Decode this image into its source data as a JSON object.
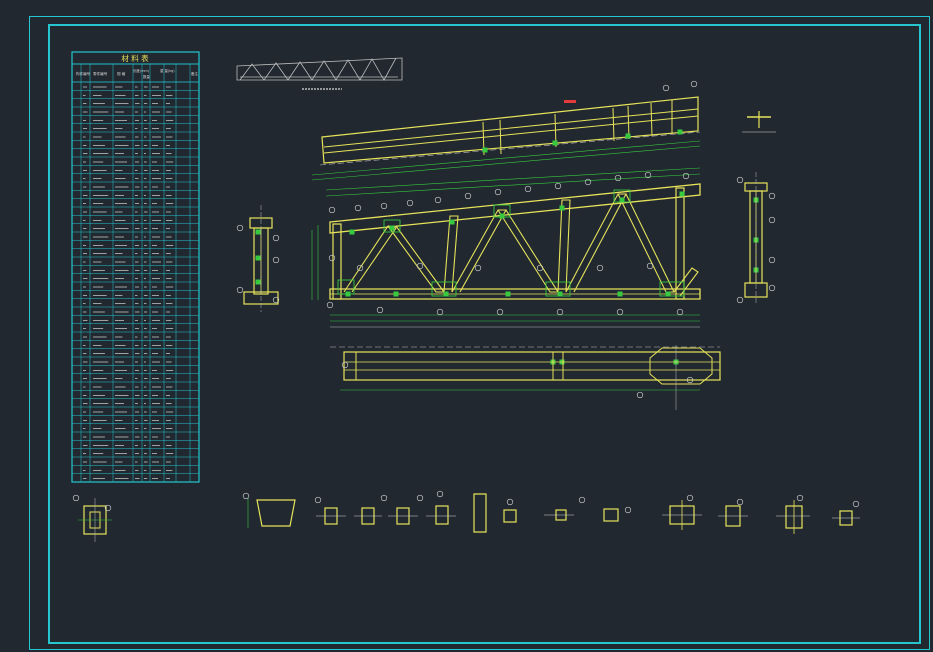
{
  "drawing": {
    "background": "#212830",
    "frame_color": "#25c6cf",
    "member_color": "#e6e25a",
    "dimension_color": "#37c93f",
    "annotation_color": "#d9d9d9",
    "callout_color": "#e33a3a"
  },
  "material_table": {
    "title": "材 料 表",
    "headers": [
      "构件编号",
      "零件编号",
      "规 格",
      "长度(mm)",
      "数量",
      "重 量(kg)",
      "备注"
    ],
    "row_count": 48
  }
}
